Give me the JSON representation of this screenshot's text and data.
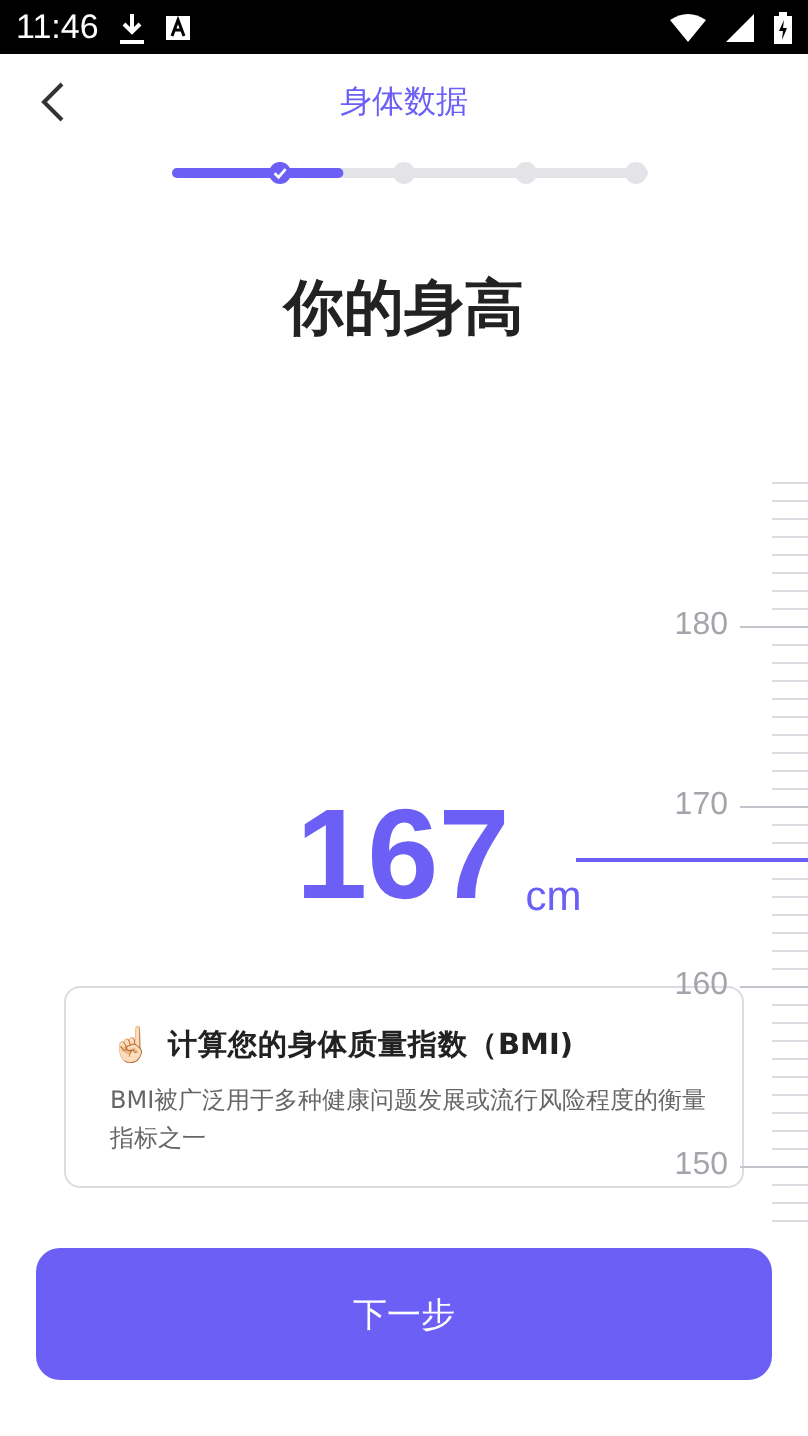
{
  "status_bar": {
    "time": "11:46"
  },
  "header": {
    "title": "身体数据"
  },
  "stepper": {
    "level": 0.36,
    "steps": [
      {
        "done": true
      },
      {
        "done": false
      },
      {
        "done": false
      },
      {
        "done": false
      }
    ]
  },
  "heading": "你的身高",
  "value": {
    "number": "167",
    "unit": "cm"
  },
  "ruler": {
    "labels": [
      "180",
      "170",
      "160",
      "150"
    ]
  },
  "info_card": {
    "emoji": "☝🏻",
    "title": "计算您的身体质量指数（BMI)",
    "body": "BMI被广泛用于多种健康问题发展或流行风险程度的衡量指标之一"
  },
  "next_button": "下一步"
}
